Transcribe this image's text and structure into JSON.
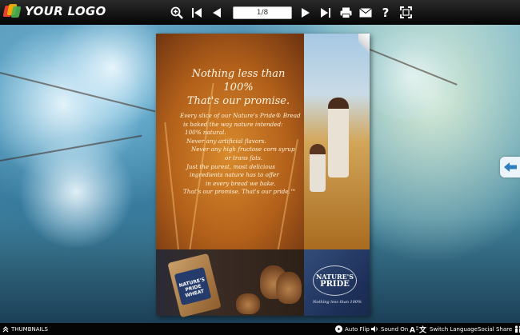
{
  "topbar": {
    "logo_text": "YOUR LOGO",
    "page_indicator": "1/8"
  },
  "icons": {
    "zoom": "zoom-in-icon",
    "first": "first-page-icon",
    "prev": "previous-page-icon",
    "next": "next-page-icon",
    "last": "last-page-icon",
    "print": "print-icon",
    "email": "email-icon",
    "help": "help-icon",
    "fullscreen": "fullscreen-icon"
  },
  "page": {
    "headline": [
      "Nothing less than 100%",
      "That's our promise."
    ],
    "body": [
      "Every slice of our Nature's Pride® Bread",
      "is baked the way nature intended:",
      "100% natural.",
      "Never any artificial flavors.",
      "Never any high fructose corn syrup",
      "or trans fats.",
      "Just the purest, most delicious",
      "ingredients nature has to offer",
      "in every bread we bake.",
      "That's our promise. That's our pride.™"
    ],
    "bag_label": "NATURE'S PRIDE WHEAT",
    "brand_logo": [
      "NATURE'S",
      "PRIDE"
    ],
    "brand_tagline": "Nothing less than 100%"
  },
  "bottombar": {
    "thumbnails": "THUMBNAILS",
    "auto_flip": "Auto Flip",
    "sound": "Sound On",
    "switch_language": "Switch Language",
    "social_share": "Social Share"
  },
  "colors": {
    "toolbar_bg": "#050505",
    "accent_blue": "#2f7fc0"
  }
}
